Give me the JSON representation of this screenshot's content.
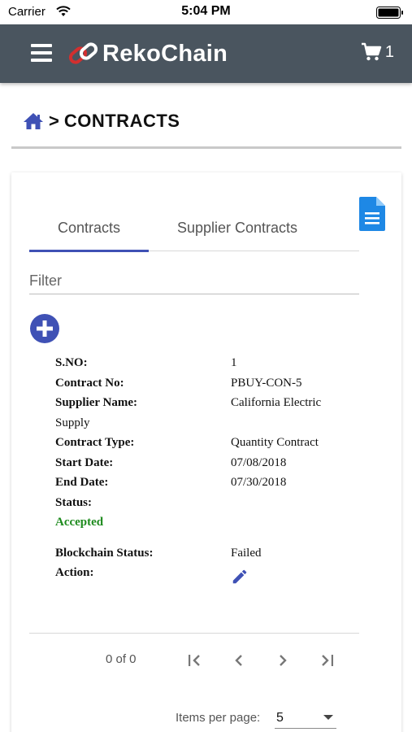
{
  "status_bar": {
    "carrier": "Carrier",
    "time": "5:04 PM"
  },
  "app_bar": {
    "logo_text": "RekoChain",
    "cart_count": "1"
  },
  "breadcrumb": {
    "separator": ">",
    "current": "CONTRACTS"
  },
  "tabs": [
    {
      "label": "Contracts",
      "active": true
    },
    {
      "label": "Supplier Contracts",
      "active": false
    }
  ],
  "filter": {
    "placeholder": "Filter",
    "value": ""
  },
  "contract": {
    "sno_label": "S.NO:",
    "sno": "1",
    "contract_no_label": "Contract No:",
    "contract_no": "PBUY-CON-5",
    "supplier_label": "Supplier Name:",
    "supplier_name_line1": "California Electric",
    "supplier_name_line2": "Supply",
    "type_label": "Contract Type:",
    "type": "Quantity Contract",
    "start_label": "Start Date:",
    "start_date": "07/08/2018",
    "end_label": "End Date:",
    "end_date": "07/30/2018",
    "status_label": "Status:",
    "status": "Accepted",
    "blockchain_label": "Blockchain Status:",
    "blockchain_status": "Failed",
    "action_label": "Action:"
  },
  "paginator": {
    "range": "0 of 0",
    "items_per_page_label": "Items per page:",
    "items_per_page": "5"
  },
  "colors": {
    "app_bar": "#4a555f",
    "accent": "#3f51b5",
    "status_accepted": "#1e8b1e",
    "doc_icon": "#1e88e5",
    "logo_red": "#d32f2f"
  },
  "icons": [
    "wifi-icon",
    "battery-icon",
    "menu-icon",
    "chain-link-icon",
    "cart-icon",
    "home-icon",
    "document-icon",
    "add-circle-icon",
    "edit-pencil-icon",
    "first-page-icon",
    "previous-page-icon",
    "next-page-icon",
    "last-page-icon",
    "dropdown-arrow-icon"
  ]
}
